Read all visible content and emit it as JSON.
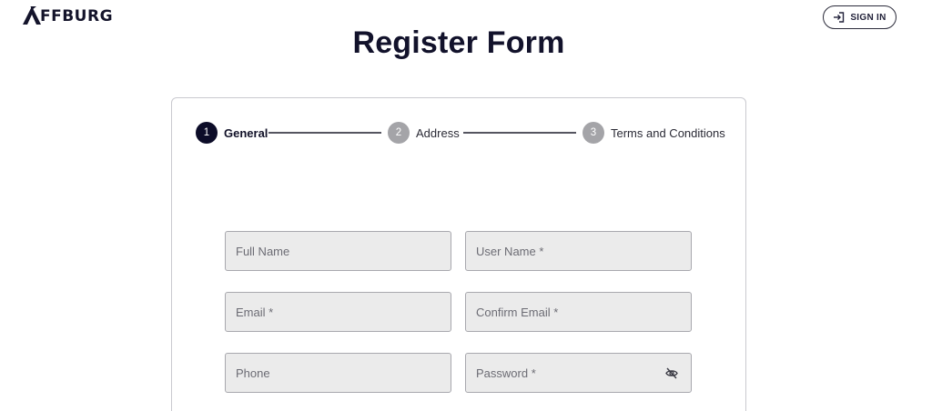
{
  "brand": {
    "name": "FFBURG",
    "logo_letter": "A"
  },
  "header": {
    "signin_label": "SIGN IN",
    "signin_icon": "login-icon"
  },
  "page": {
    "title": "Register Form"
  },
  "stepper": {
    "steps": [
      {
        "number": "1",
        "label": "General",
        "state": "active"
      },
      {
        "number": "2",
        "label": "Address",
        "state": "inactive"
      },
      {
        "number": "3",
        "label": "Terms and Conditions",
        "state": "inactive"
      }
    ]
  },
  "form": {
    "full_name": {
      "label": "Full Name",
      "value": ""
    },
    "user_name": {
      "label": "User Name *",
      "value": ""
    },
    "email": {
      "label": "Email *",
      "value": ""
    },
    "confirm_email": {
      "label": "Confirm Email *",
      "value": ""
    },
    "phone": {
      "label": "Phone",
      "value": ""
    },
    "password": {
      "label": "Password *",
      "value": "",
      "toggle_icon": "eye-off-icon"
    }
  },
  "colors": {
    "primary": "#0c0c28",
    "step_inactive": "#a4a4a8",
    "field_bg": "#ebebeb",
    "border": "#c9c9cf"
  }
}
